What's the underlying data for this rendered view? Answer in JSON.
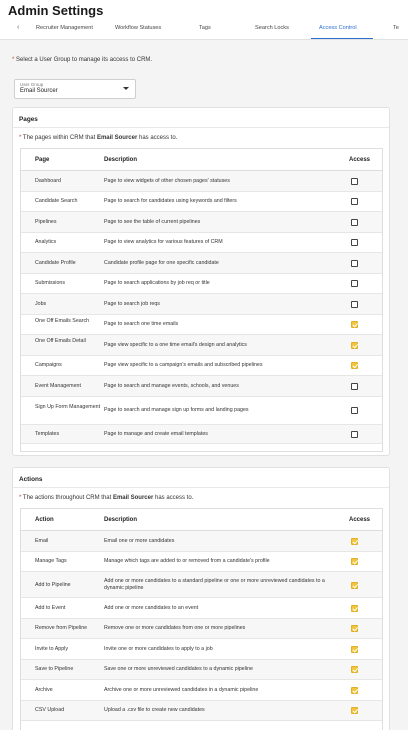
{
  "header": {
    "title": "Admin Settings"
  },
  "tabs": [
    {
      "label": "Recruiter Management",
      "active": false
    },
    {
      "label": "Workflow Statuses",
      "active": false
    },
    {
      "label": "Tags",
      "active": false
    },
    {
      "label": "Search Locks",
      "active": false
    },
    {
      "label": "Access Control",
      "active": true
    },
    {
      "label": "Te",
      "active": false
    }
  ],
  "hint": {
    "asterisk": "*",
    "text": "Select a User Group to manage its access to CRM."
  },
  "user_group": {
    "label": "User Group",
    "value": "Email Sourcer"
  },
  "pages_section": {
    "title": "Pages",
    "sub_prefix": "The pages within CRM that ",
    "sub_group": "Email Sourcer",
    "sub_suffix": " has access to.",
    "columns": {
      "name": "Page",
      "description": "Description",
      "access": "Access"
    },
    "rows": [
      {
        "name": "Dashboard",
        "description": "Page to view widgets of other chosen pages' statuses",
        "access": false
      },
      {
        "name": "Candidate Search",
        "description": "Page to search for candidates using keywords and filters",
        "access": false
      },
      {
        "name": "Pipelines",
        "description": "Page to see the table of current pipelines",
        "access": false
      },
      {
        "name": "Analytics",
        "description": "Page to view analytics for various features of CRM",
        "access": false
      },
      {
        "name": "Candidate Profile",
        "description": "Candidate profile page for one specific candidate",
        "access": false
      },
      {
        "name": "Submissions",
        "description": "Page to search applications by job req or title",
        "access": false
      },
      {
        "name": "Jobs",
        "description": "Page to search job reqs",
        "access": false
      },
      {
        "name": "One Off Emails Search",
        "description": "Page to search one time emails",
        "access": true
      },
      {
        "name": "One Off Emails Detail",
        "description": "Page view specific to a one time email's design and analytics",
        "access": true
      },
      {
        "name": "Campaigns",
        "description": "Page view specific to a campaign's emails and subscribed pipelines",
        "access": true
      },
      {
        "name": "Event Management",
        "description": "Page to search and manage events, schools, and venues",
        "access": false
      },
      {
        "name": "Sign Up Form Management",
        "description": "Page to search and manage sign up forms and landing pages",
        "access": false
      },
      {
        "name": "Templates",
        "description": "Page to manage and create email templates",
        "access": false
      }
    ]
  },
  "actions_section": {
    "title": "Actions",
    "sub_prefix": "The actions throughout CRM that ",
    "sub_group": "Email Sourcer",
    "sub_suffix": " has access to.",
    "columns": {
      "name": "Action",
      "description": "Description",
      "access": "Access"
    },
    "rows": [
      {
        "name": "Email",
        "description": "Email one or more candidates",
        "access": true
      },
      {
        "name": "Manage Tags",
        "description": "Manage which tags are added to or removed from a candidate's profile",
        "access": true
      },
      {
        "name": "Add to Pipeline",
        "description": "Add one or more candidates to a standard pipeline or one or more unreviewed candidates to a dynamic pipeline",
        "access": true
      },
      {
        "name": "Add to Event",
        "description": "Add one or more candidates to an event",
        "access": true
      },
      {
        "name": "Remove from Pipeline",
        "description": "Remove one or more candidates from one or more pipelines",
        "access": true
      },
      {
        "name": "Invite to Apply",
        "description": "Invite one or more candidates to apply to a job",
        "access": true
      },
      {
        "name": "Save to Pipeline",
        "description": "Save one or more unreviewed candidates to a dynamic pipeline",
        "access": true
      },
      {
        "name": "Archive",
        "description": "Archive one or more unreviewed candidates in a dynamic pipeline",
        "access": true
      },
      {
        "name": "CSV Upload",
        "description": "Upload a .csv file to create new candidates",
        "access": true
      }
    ]
  },
  "colors": {
    "accent": "#2c6fd1",
    "checked": "#f2c53d",
    "asterisk": "#c0392b"
  }
}
